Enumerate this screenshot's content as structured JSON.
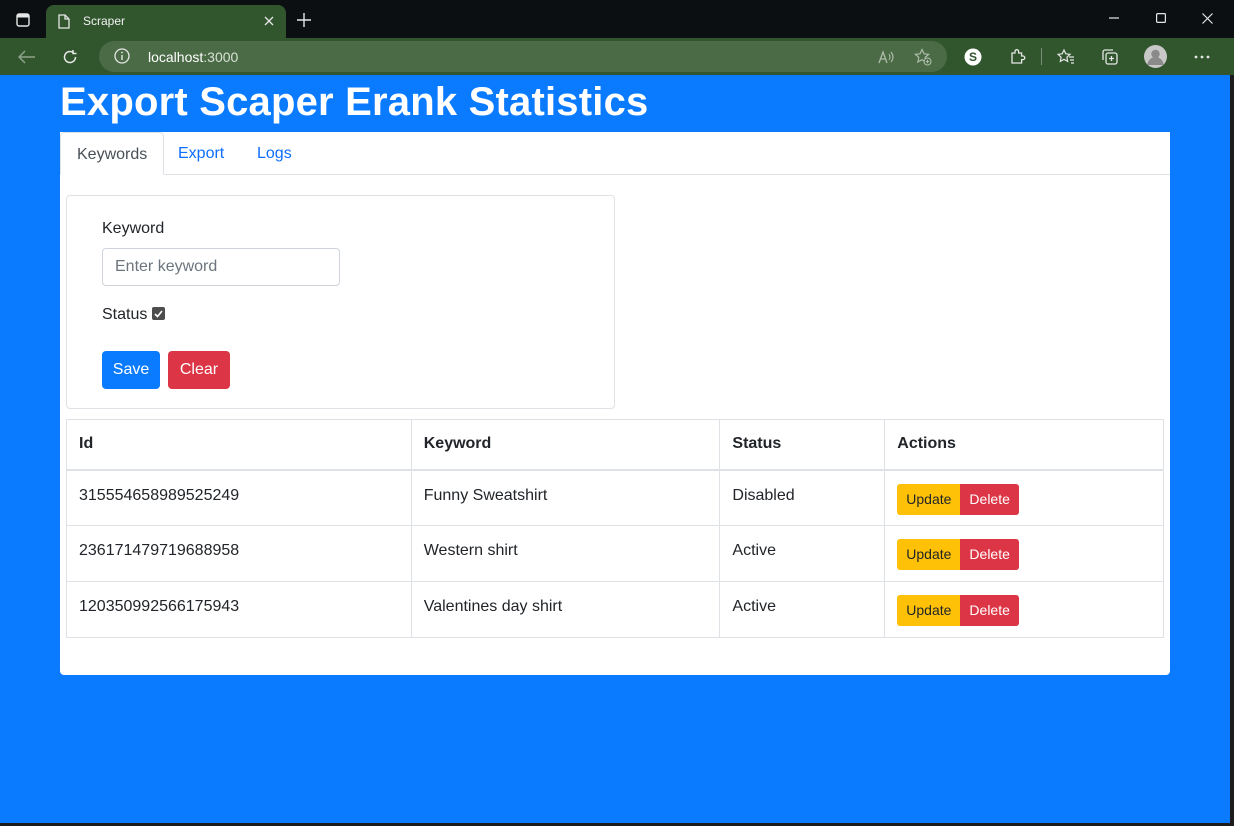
{
  "browser": {
    "tab_title": "Scraper",
    "url_host": "localhost",
    "url_port": ":3000"
  },
  "page": {
    "title": "Export Scaper Erank Statistics"
  },
  "tabs": [
    {
      "label": "Keywords",
      "active": true
    },
    {
      "label": "Export",
      "active": false
    },
    {
      "label": "Logs",
      "active": false
    }
  ],
  "form": {
    "keyword_label": "Keyword",
    "keyword_placeholder": "Enter keyword",
    "keyword_value": "",
    "status_label": "Status",
    "status_checked": true,
    "save_label": "Save",
    "clear_label": "Clear"
  },
  "table": {
    "headers": [
      "Id",
      "Keyword",
      "Status",
      "Actions"
    ],
    "rows": [
      {
        "id": "315554658989525249",
        "keyword": "Funny Sweatshirt",
        "status": "Disabled"
      },
      {
        "id": "236171479719688958",
        "keyword": "Western shirt",
        "status": "Active"
      },
      {
        "id": "120350992566175943",
        "keyword": "Valentines day shirt",
        "status": "Active"
      }
    ],
    "update_label": "Update",
    "delete_label": "Delete"
  },
  "colors": {
    "page_bg": "#0a7bfe",
    "primary": "#0a7bfe",
    "danger": "#dc3545",
    "warning": "#ffc107",
    "browser_toolbar": "#31562e"
  }
}
